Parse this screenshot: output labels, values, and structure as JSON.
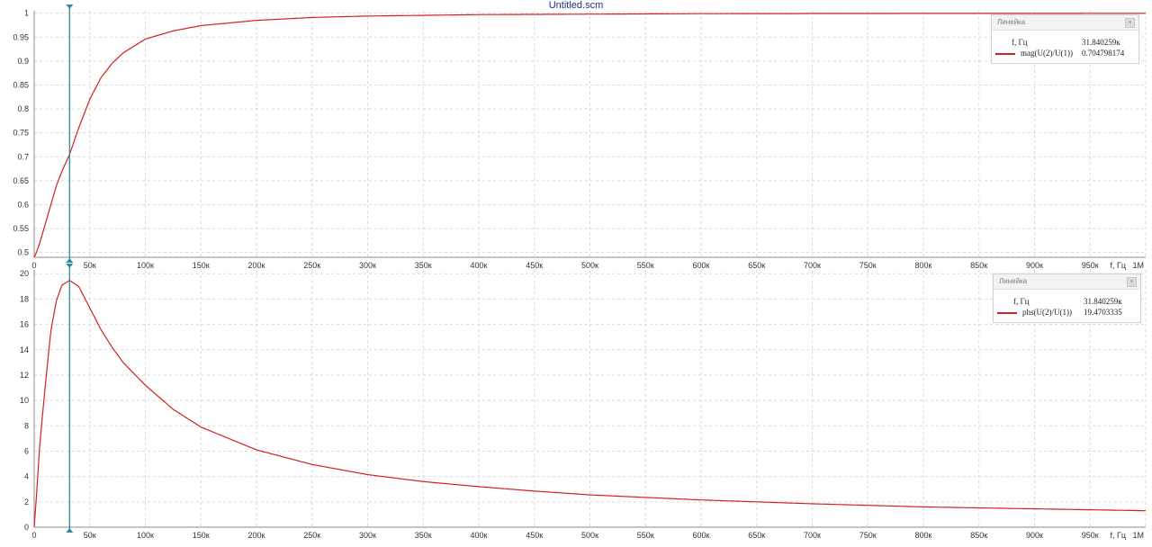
{
  "window": {
    "title": "Untitled.scm"
  },
  "colors": {
    "curve": "#d42020",
    "cursor": "#2f8aa0",
    "grid": "#d9d9d9",
    "axis": "#8a8a8a"
  },
  "cursor": {
    "frequency": 31840.259
  },
  "x_axis": {
    "label": "f, Гц",
    "ticks": [
      "0",
      "50к",
      "100к",
      "150к",
      "200к",
      "250к",
      "300к",
      "350к",
      "400к",
      "450к",
      "500к",
      "550к",
      "600к",
      "650к",
      "700к",
      "750к",
      "800к",
      "850к",
      "900к",
      "950к",
      "1М"
    ]
  },
  "top_plot": {
    "y_ticks": [
      "0.5",
      "0.55",
      "0.6",
      "0.65",
      "0.7",
      "0.75",
      "0.8",
      "0.85",
      "0.9",
      "0.95",
      "1"
    ],
    "legend": {
      "title": "Линейка",
      "close_glyph": "×",
      "x_name": "f, Гц",
      "x_value": "31.840259к",
      "series_name": "mag(U(2)/U(1))",
      "series_value": "0.704798174"
    }
  },
  "bottom_plot": {
    "y_ticks": [
      "0",
      "2",
      "4",
      "6",
      "8",
      "10",
      "12",
      "14",
      "16",
      "18",
      "20"
    ],
    "legend": {
      "title": "Линейка",
      "close_glyph": "×",
      "x_name": "f, Гц",
      "x_value": "31.840259к",
      "series_name": "phs(U(2)/U(1))",
      "series_value": "19.4703335"
    }
  },
  "chart_data": [
    {
      "type": "line",
      "xlabel": "f, Гц",
      "xlim": [
        0,
        1000000
      ],
      "ylim": [
        0.49,
        1.005
      ],
      "series": [
        {
          "name": "mag(U(2)/U(1))",
          "x": [
            0,
            2000,
            5000,
            10000,
            15000,
            20000,
            25000,
            31840,
            40000,
            50000,
            60000,
            70000,
            80000,
            100000,
            125000,
            150000,
            200000,
            250000,
            300000,
            400000,
            500000,
            600000,
            700000,
            800000,
            900000,
            1000000
          ],
          "y": [
            0.49,
            0.5,
            0.52,
            0.56,
            0.6,
            0.64,
            0.67,
            0.705,
            0.76,
            0.82,
            0.865,
            0.895,
            0.917,
            0.946,
            0.963,
            0.974,
            0.985,
            0.991,
            0.994,
            0.997,
            0.998,
            0.999,
            0.9993,
            0.9995,
            0.9996,
            0.9997
          ]
        }
      ]
    },
    {
      "type": "line",
      "xlabel": "f, Гц",
      "xlim": [
        0,
        1000000
      ],
      "ylim": [
        0,
        20.3
      ],
      "series": [
        {
          "name": "phs(U(2)/U(1))",
          "x": [
            0,
            2000,
            5000,
            10000,
            15000,
            20000,
            25000,
            31840,
            40000,
            50000,
            60000,
            70000,
            80000,
            100000,
            125000,
            150000,
            200000,
            250000,
            300000,
            350000,
            400000,
            450000,
            500000,
            600000,
            700000,
            800000,
            900000,
            1000000
          ],
          "y": [
            0,
            2.4,
            6.5,
            11.2,
            15.5,
            17.9,
            19.1,
            19.47,
            19.0,
            17.3,
            15.6,
            14.2,
            13.0,
            11.2,
            9.3,
            7.9,
            6.1,
            4.95,
            4.15,
            3.6,
            3.2,
            2.85,
            2.55,
            2.15,
            1.85,
            1.6,
            1.45,
            1.3
          ]
        }
      ]
    }
  ]
}
